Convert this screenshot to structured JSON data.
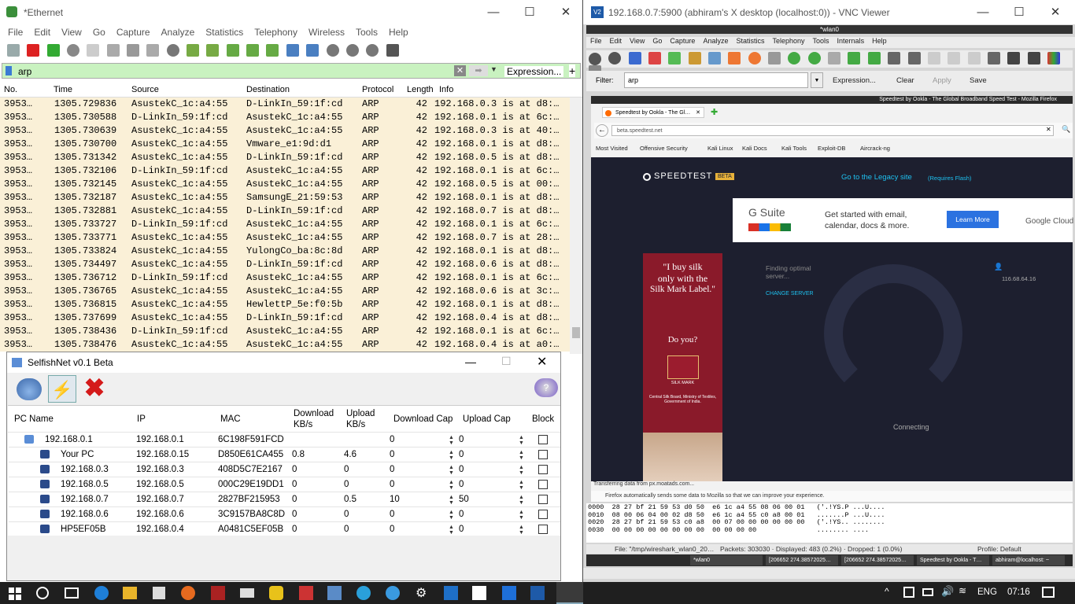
{
  "wireshark": {
    "title": "*Ethernet",
    "menu": [
      "File",
      "Edit",
      "View",
      "Go",
      "Capture",
      "Analyze",
      "Statistics",
      "Telephony",
      "Wireless",
      "Tools",
      "Help"
    ],
    "filter": {
      "value": "arp",
      "expression_label": "Expression...",
      "plus": "+"
    },
    "columns": [
      "No.",
      "Time",
      "Source",
      "Destination",
      "Protocol",
      "Length",
      "Info"
    ],
    "packets": [
      {
        "no": "3953…",
        "time": "1305.729836",
        "src": "AsustekC_1c:a4:55",
        "dst": "D-LinkIn_59:1f:cd",
        "proto": "ARP",
        "len": "42",
        "info": "192.168.0.3 is at d8:…"
      },
      {
        "no": "3953…",
        "time": "1305.730588",
        "src": "D-LinkIn_59:1f:cd",
        "dst": "AsustekC_1c:a4:55",
        "proto": "ARP",
        "len": "42",
        "info": "192.168.0.1 is at 6c:…"
      },
      {
        "no": "3953…",
        "time": "1305.730639",
        "src": "AsustekC_1c:a4:55",
        "dst": "AsustekC_1c:a4:55",
        "proto": "ARP",
        "len": "42",
        "info": "192.168.0.3 is at 40:…"
      },
      {
        "no": "3953…",
        "time": "1305.730700",
        "src": "AsustekC_1c:a4:55",
        "dst": "Vmware_e1:9d:d1",
        "proto": "ARP",
        "len": "42",
        "info": "192.168.0.1 is at d8:…"
      },
      {
        "no": "3953…",
        "time": "1305.731342",
        "src": "AsustekC_1c:a4:55",
        "dst": "D-LinkIn_59:1f:cd",
        "proto": "ARP",
        "len": "42",
        "info": "192.168.0.5 is at d8:…"
      },
      {
        "no": "3953…",
        "time": "1305.732106",
        "src": "D-LinkIn_59:1f:cd",
        "dst": "AsustekC_1c:a4:55",
        "proto": "ARP",
        "len": "42",
        "info": "192.168.0.1 is at 6c:…"
      },
      {
        "no": "3953…",
        "time": "1305.732145",
        "src": "AsustekC_1c:a4:55",
        "dst": "AsustekC_1c:a4:55",
        "proto": "ARP",
        "len": "42",
        "info": "192.168.0.5 is at 00:…"
      },
      {
        "no": "3953…",
        "time": "1305.732187",
        "src": "AsustekC_1c:a4:55",
        "dst": "SamsungE_21:59:53",
        "proto": "ARP",
        "len": "42",
        "info": "192.168.0.1 is at d8:…"
      },
      {
        "no": "3953…",
        "time": "1305.732881",
        "src": "AsustekC_1c:a4:55",
        "dst": "D-LinkIn_59:1f:cd",
        "proto": "ARP",
        "len": "42",
        "info": "192.168.0.7 is at d8:…"
      },
      {
        "no": "3953…",
        "time": "1305.733727",
        "src": "D-LinkIn_59:1f:cd",
        "dst": "AsustekC_1c:a4:55",
        "proto": "ARP",
        "len": "42",
        "info": "192.168.0.1 is at 6c:…"
      },
      {
        "no": "3953…",
        "time": "1305.733771",
        "src": "AsustekC_1c:a4:55",
        "dst": "AsustekC_1c:a4:55",
        "proto": "ARP",
        "len": "42",
        "info": "192.168.0.7 is at 28:…"
      },
      {
        "no": "3953…",
        "time": "1305.733824",
        "src": "AsustekC_1c:a4:55",
        "dst": "YulongCo_ba:8c:8d",
        "proto": "ARP",
        "len": "42",
        "info": "192.168.0.1 is at d8:…"
      },
      {
        "no": "3953…",
        "time": "1305.734497",
        "src": "AsustekC_1c:a4:55",
        "dst": "D-LinkIn_59:1f:cd",
        "proto": "ARP",
        "len": "42",
        "info": "192.168.0.6 is at d8:…"
      },
      {
        "no": "3953…",
        "time": "1305.736712",
        "src": "D-LinkIn_59:1f:cd",
        "dst": "AsustekC_1c:a4:55",
        "proto": "ARP",
        "len": "42",
        "info": "192.168.0.1 is at 6c:…"
      },
      {
        "no": "3953…",
        "time": "1305.736765",
        "src": "AsustekC_1c:a4:55",
        "dst": "AsustekC_1c:a4:55",
        "proto": "ARP",
        "len": "42",
        "info": "192.168.0.6 is at 3c:…"
      },
      {
        "no": "3953…",
        "time": "1305.736815",
        "src": "AsustekC_1c:a4:55",
        "dst": "HewlettP_5e:f0:5b",
        "proto": "ARP",
        "len": "42",
        "info": "192.168.0.1 is at d8:…"
      },
      {
        "no": "3953…",
        "time": "1305.737699",
        "src": "AsustekC_1c:a4:55",
        "dst": "D-LinkIn_59:1f:cd",
        "proto": "ARP",
        "len": "42",
        "info": "192.168.0.4 is at d8:…"
      },
      {
        "no": "3953…",
        "time": "1305.738436",
        "src": "D-LinkIn_59:1f:cd",
        "dst": "AsustekC_1c:a4:55",
        "proto": "ARP",
        "len": "42",
        "info": "192.168.0.1 is at 6c:…"
      },
      {
        "no": "3953…",
        "time": "1305.738476",
        "src": "AsustekC_1c:a4:55",
        "dst": "AsustekC_1c:a4:55",
        "proto": "ARP",
        "len": "42",
        "info": "192.168.0.4 is at a0:…"
      }
    ]
  },
  "selfishnet": {
    "title": "SelfishNet v0.1 Beta",
    "columns": {
      "pc": "PC Name",
      "ip": "IP",
      "mac": "MAC",
      "dl1": "Download",
      "dl2": "KB/s",
      "ul1": "Upload",
      "ul2": "KB/s",
      "dcap": "Download Cap",
      "ucap": "Upload Cap",
      "block": "Block"
    },
    "rows": [
      {
        "pc": "192.168.0.1",
        "ip": "192.168.0.1",
        "mac": "6C198F591FCD",
        "dl": "",
        "ul": "",
        "dcap": "0",
        "ucap": "0"
      },
      {
        "pc": "Your PC",
        "ip": "192.168.0.15",
        "mac": "D850E61CA455",
        "dl": "0.8",
        "ul": "4.6",
        "dcap": "0",
        "ucap": "0"
      },
      {
        "pc": "192.168.0.3",
        "ip": "192.168.0.3",
        "mac": "408D5C7E2167",
        "dl": "0",
        "ul": "0",
        "dcap": "0",
        "ucap": "0"
      },
      {
        "pc": "192.168.0.5",
        "ip": "192.168.0.5",
        "mac": "000C29E19DD1",
        "dl": "0",
        "ul": "0",
        "dcap": "0",
        "ucap": "0"
      },
      {
        "pc": "192.168.0.7",
        "ip": "192.168.0.7",
        "mac": "2827BF215953",
        "dl": "0",
        "ul": "0.5",
        "dcap": "10",
        "ucap": "50"
      },
      {
        "pc": "192.168.0.6",
        "ip": "192.168.0.6",
        "mac": "3C9157BA8C8D",
        "dl": "0",
        "ul": "0",
        "dcap": "0",
        "ucap": "0"
      },
      {
        "pc": "HP5EF05B",
        "ip": "192.168.0.4",
        "mac": "A0481C5EF05B",
        "dl": "0",
        "ul": "0",
        "dcap": "0",
        "ucap": "0"
      }
    ]
  },
  "vnc": {
    "title": "192.168.0.7:5900 (abhiram's X desktop (localhost:0)) - VNC Viewer",
    "inner_title": "*wlan0",
    "menu": [
      "File",
      "Edit",
      "View",
      "Go",
      "Capture",
      "Analyze",
      "Statistics",
      "Telephony",
      "Tools",
      "Internals",
      "Help"
    ],
    "filter_label": "Filter:",
    "filter_value": "arp",
    "filter_buttons": [
      "Expression...",
      "Clear",
      "Apply",
      "Save"
    ],
    "firefox": {
      "window_title": "Speedtest by Ookla - The Global Broadband Speed Test - Mozilla Firefox",
      "tab": "Speedtest by Ookla - The Gl…",
      "url": "beta.speedtest.net",
      "bookmarks": [
        "Most Visited",
        "Offensive Security",
        "Kali Linux",
        "Kali Docs",
        "Kali Tools",
        "Exploit-DB",
        "Aircrack-ng"
      ],
      "brand": "SPEEDTEST",
      "beta": "BETA",
      "legacy": "Go to the Legacy site",
      "legacy_note": "(Requires Flash)",
      "ad_brand": "G Suite",
      "ad_text1": "Get started with email,",
      "ad_text2": "calendar, docs & more.",
      "ad_button": "Learn More",
      "ad_google": "Google Cloud",
      "silk1": "\"I buy silk",
      "silk2": "only with the",
      "silk3": "Silk Mark Label.\"",
      "silk4": "Do you?",
      "silk5": "SILK MARK",
      "silk6": "Central Silk Board, Ministry of Textiles, Government of India.",
      "finding": "Finding optimal server...",
      "change_server": "CHANGE SERVER",
      "user_ip": "116.68.64.16",
      "connecting": "Connecting",
      "status": "Transferring data from px.moatads.com...",
      "notice": "Firefox automatically sends some data to Mozilla so that we can improve your experience."
    },
    "hex": [
      "0000  28 27 bf 21 59 53 d0 50  e6 1c a4 55 08 06 00 01   ('.!YS.P ...U....",
      "0010  08 00 06 04 00 02 d8 50  e6 1c a4 55 c0 a8 00 01   .......P ...U....",
      "0020  28 27 bf 21 59 53 c0 a8  00 07 00 00 00 00 00 00   ('.!YS.. ........",
      "0030  00 00 00 00 00 00 00 00  00 00 00 00               ........ ...."
    ],
    "statusbar": {
      "file": "File: \"/tmp/wireshark_wlan0_20…",
      "packets": "Packets: 303030 · Displayed: 483 (0.2%) · Dropped: 1 (0.0%)",
      "profile": "Profile: Default"
    },
    "taskbar": [
      "*wlan0",
      "[206652 274.38572025…",
      "[206652 274.38572025…",
      "Speedtest by Ookla - T…",
      "abhiram@localhost: ~"
    ]
  },
  "taskbar": {
    "lang": "ENG",
    "time": "07:16"
  }
}
